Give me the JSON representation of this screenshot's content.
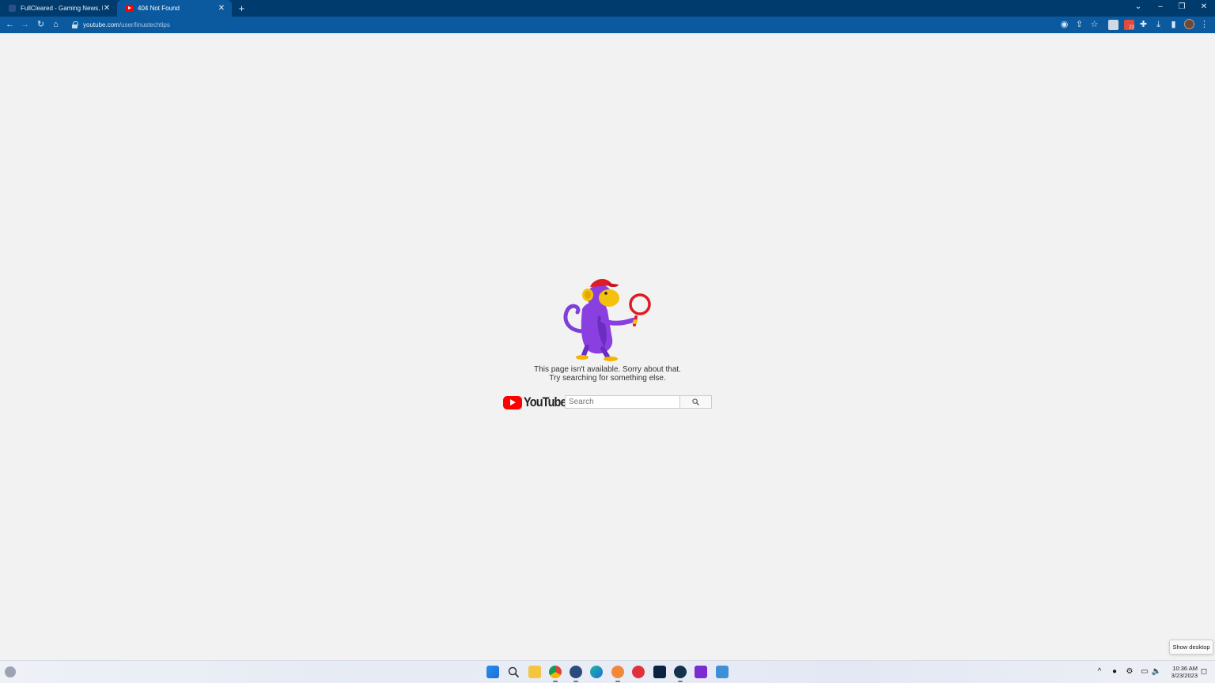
{
  "browser": {
    "tabs": [
      {
        "title": "FullCleared - Gaming News, Features",
        "active": false
      },
      {
        "title": "404 Not Found",
        "active": true
      }
    ],
    "new_tab_label": "+",
    "address": {
      "host": "youtube.com",
      "path": "/user/linustechtips"
    },
    "extension_badge": "22"
  },
  "page": {
    "message_line1": "This page isn't available. Sorry about that.",
    "message_line2": "Try searching for something else.",
    "logo_text": "YouTube",
    "search_placeholder": "Search"
  },
  "taskbar": {
    "time": "10:36 AM",
    "date": "3/23/2023",
    "show_desktop_tooltip": "Show desktop"
  },
  "colors": {
    "tabstrip_bg": "#003b6e",
    "toolbar_bg": "#0b5aa0",
    "page_bg": "#f2f2f2",
    "youtube_red": "#ff0000"
  }
}
